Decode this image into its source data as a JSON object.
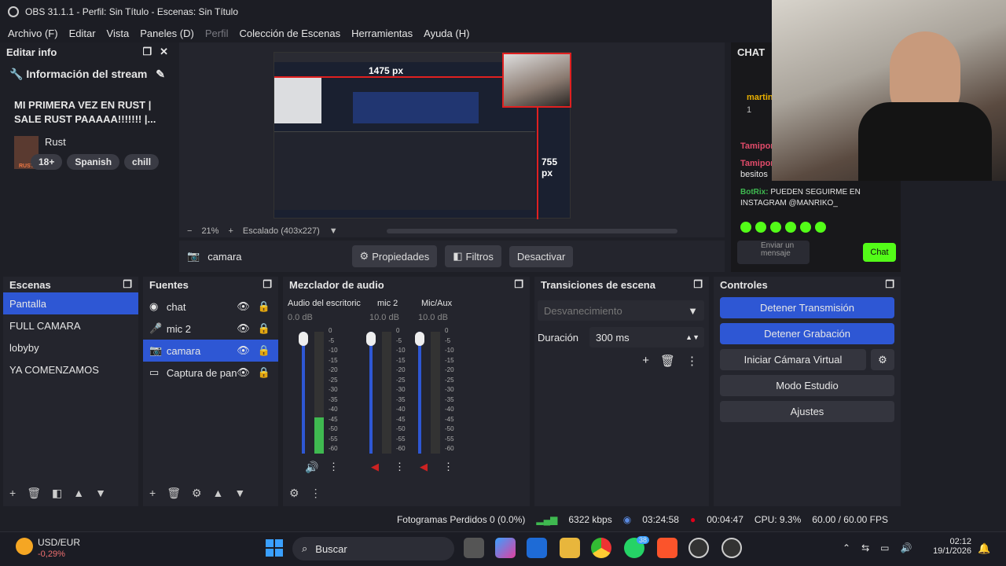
{
  "window": {
    "title": "OBS 31.1.1 - Perfil: Sin Título - Escenas: Sin Título"
  },
  "menu": [
    "Archivo (F)",
    "Editar",
    "Vista",
    "Paneles (D)",
    "Perfil",
    "Colección de Escenas",
    "Herramientas",
    "Ayuda (H)"
  ],
  "info": {
    "header": "Editar info",
    "stream_title": "Información del stream",
    "headline": "MI PRIMERA VEZ EN RUST | SALE RUST PAAAAA!!!!!!! |...",
    "game": "Rust",
    "game_logo": "RUST",
    "tags": [
      "18+",
      "Spanish",
      "chill"
    ]
  },
  "preview": {
    "width_label": "1475 px",
    "height_label": "755 px",
    "zoom": "21%",
    "scale": "Escalado (403x227)"
  },
  "source_bar": {
    "source": "camara",
    "properties": "Propiedades",
    "filters": "Filtros",
    "disable": "Desactivar"
  },
  "scenes": {
    "title": "Escenas",
    "items": [
      "Pantalla",
      "FULL CAMARA",
      "lobyby",
      "YA COMENZAMOS"
    ]
  },
  "sources": {
    "title": "Fuentes",
    "items": [
      "chat",
      "mic 2",
      "camara",
      "Captura de pan"
    ]
  },
  "mixer": {
    "title": "Mezclador de audio",
    "channels": [
      {
        "name": "Audio del escritoric",
        "db": "0.0 dB",
        "level": 0.3
      },
      {
        "name": "mic 2",
        "db": "10.0 dB",
        "level": 0.0
      },
      {
        "name": "Mic/Aux",
        "db": "10.0 dB",
        "level": 0.0
      }
    ],
    "scale": [
      "0",
      "-5",
      "-10",
      "-15",
      "-20",
      "-25",
      "-30",
      "-35",
      "-40",
      "-45",
      "-50",
      "-55",
      "-60"
    ]
  },
  "transitions": {
    "title": "Transiciones de escena",
    "type": "Desvanecimiento",
    "duration_label": "Duración",
    "duration": "300 ms"
  },
  "controls": {
    "title": "Controles",
    "stop_stream": "Detener Transmisión",
    "stop_record": "Detener Grabación",
    "virtual_cam": "Iniciar Cámara Virtual",
    "studio": "Modo Estudio",
    "settings": "Ajustes"
  },
  "chat": {
    "title": "CHAT",
    "user1": "martin",
    "count": "1",
    "user2": "Tamipon",
    "user3": "Tamipon",
    "msg3": "besitos",
    "bot": "BotRix:",
    "bot_msg": "PUEDEN SEGUIRME EN INSTAGRAM @MANRIKO_",
    "placeholder": "Enviar un mensaje",
    "send": "Chat"
  },
  "status": {
    "dropped": "Fotogramas Perdidos 0 (0.0%)",
    "bitrate": "6322 kbps",
    "stream_time": "03:24:58",
    "rec_time": "00:04:47",
    "cpu": "CPU: 9.3%",
    "fps": "60.00 / 60.00 FPS"
  },
  "taskbar": {
    "ticker": "USD/EUR",
    "change": "-0,29%",
    "search": "Buscar",
    "badge": "38",
    "time": "02:12",
    "date": "19/1/2026"
  },
  "colors": {
    "accent": "#2e57d4",
    "live": "#e0001a"
  }
}
